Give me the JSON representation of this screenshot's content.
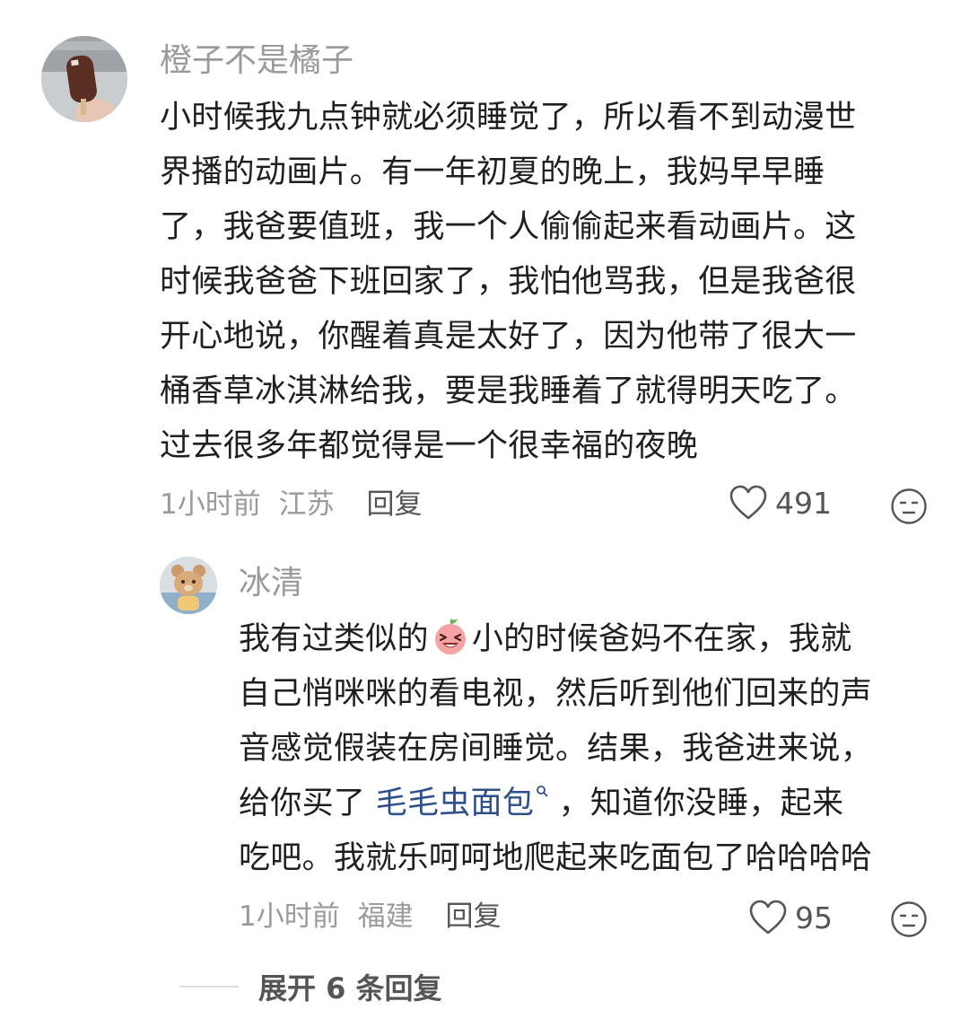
{
  "comments": [
    {
      "username": "橙子不是橘子",
      "avatar": "ice-cream-bar-photo",
      "lines": [
        "小时候我九点钟就必须睡觉了，所以看不到动漫世",
        "界播的动画片。有一年初夏的晚上，我妈早早睡",
        "了，我爸要值班，我一个人偷偷起来看动画片。这",
        "时候我爸爸下班回家了，我怕他骂我，但是我爸很",
        "开心地说，你醒着真是太好了，因为他带了很大一",
        "桶香草冰淇淋给我，要是我睡着了就得明天吃了。",
        "过去很多年都觉得是一个很幸福的夜晚"
      ],
      "time": "1小时前",
      "location": "江苏",
      "reply_label": "回复",
      "likes": "491"
    }
  ],
  "reply": {
    "username": "冰清",
    "avatar": "cartoon-bear-photo",
    "line1_before_emoji": "我有过类似的",
    "emoji": "laughing-peach-emoji",
    "line1_after_emoji": "小的时候爸妈不在家，我就",
    "line2": "自己悄咪咪的看电视，然后听到他们回来的声",
    "line3": "音感觉假装在房间睡觉。结果，我爸进来说，",
    "line4_before_link": "给你买了 ",
    "link_text": "毛毛虫面包",
    "line4_after_link": " ，知道你没睡，起来",
    "line5": "吃吧。我就乐呵呵地爬起来吃面包了哈哈哈哈",
    "time": "1小时前",
    "location": "福建",
    "reply_label": "回复",
    "likes": "95"
  },
  "expand_label": "展开 6 条回复",
  "colors": {
    "meta": "#9a9a9a",
    "text": "#1f1f1f",
    "link": "#2d4f8a"
  }
}
